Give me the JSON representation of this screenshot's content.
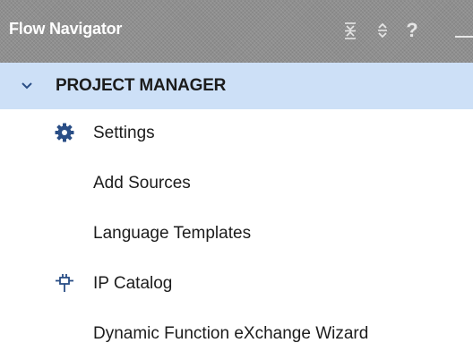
{
  "header": {
    "title": "Flow Navigator",
    "help_glyph": "?",
    "icons": {
      "collapse_all": "collapse-all-icon",
      "expand_all": "expand-all-icon",
      "help": "help-icon",
      "minimize": "minimize-icon"
    }
  },
  "section": {
    "label": "PROJECT MANAGER",
    "expanded": true,
    "icon": "chevron-down-icon"
  },
  "items": [
    {
      "label": "Settings",
      "icon": "gear-icon"
    },
    {
      "label": "Add Sources",
      "icon": ""
    },
    {
      "label": "Language Templates",
      "icon": ""
    },
    {
      "label": "IP Catalog",
      "icon": "ip-core-icon"
    },
    {
      "label": "Dynamic Function eXchange Wizard",
      "icon": ""
    }
  ],
  "colors": {
    "header_bg": "#8f8f8f",
    "header_text": "#ffffff",
    "selected_row_bg": "#cde0f7",
    "icon_blue": "#2a4e86",
    "text": "#1c1c1c"
  }
}
